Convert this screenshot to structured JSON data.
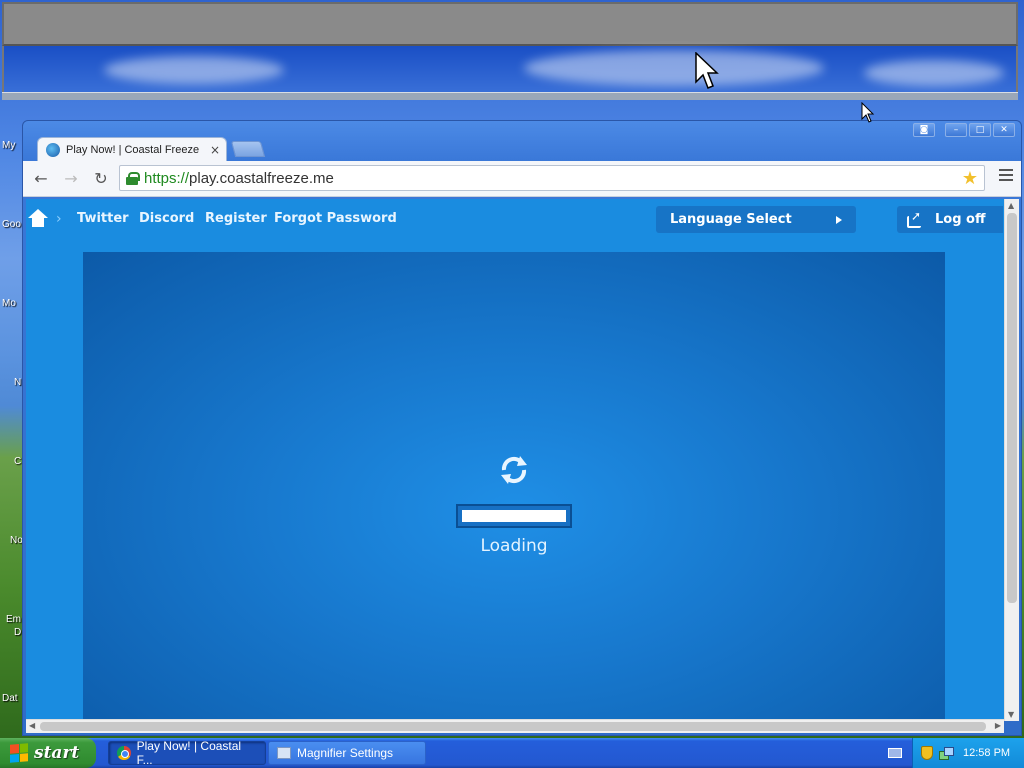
{
  "desktop": {
    "labels": [
      "My",
      "Goo",
      "Mo",
      "N",
      "C",
      "No",
      "Em",
      "D",
      "Dat"
    ]
  },
  "browser": {
    "tab": {
      "title": "Play Now! | Coastal Freeze",
      "close": "×"
    },
    "url_scheme": "https://",
    "url_host": "play.coastalfreeze.me",
    "window_controls": {
      "minimize": "–",
      "maximize": "□",
      "close": "✕"
    }
  },
  "site_nav": {
    "links": [
      "Twitter",
      "Discord",
      "Register",
      "Forgot Password"
    ],
    "language_select": "Language Select",
    "logoff": "Log off"
  },
  "game": {
    "loading_text": "Loading",
    "progress": 1.0
  },
  "taskbar": {
    "start_label": "start",
    "tasks": [
      {
        "label": "Play Now! | Coastal F...",
        "icon": "chrome-icon",
        "active": true
      },
      {
        "label": "Magnifier Settings",
        "icon": "magnifier-icon",
        "active": false
      }
    ],
    "clock": "12:58 PM"
  },
  "colors": {
    "page_bg": "#1a8ce0",
    "game_bg": "#1777cc",
    "nav_button": "#1774c6",
    "start_green": "#3c9a3c",
    "taskbar_blue": "#245edb"
  }
}
